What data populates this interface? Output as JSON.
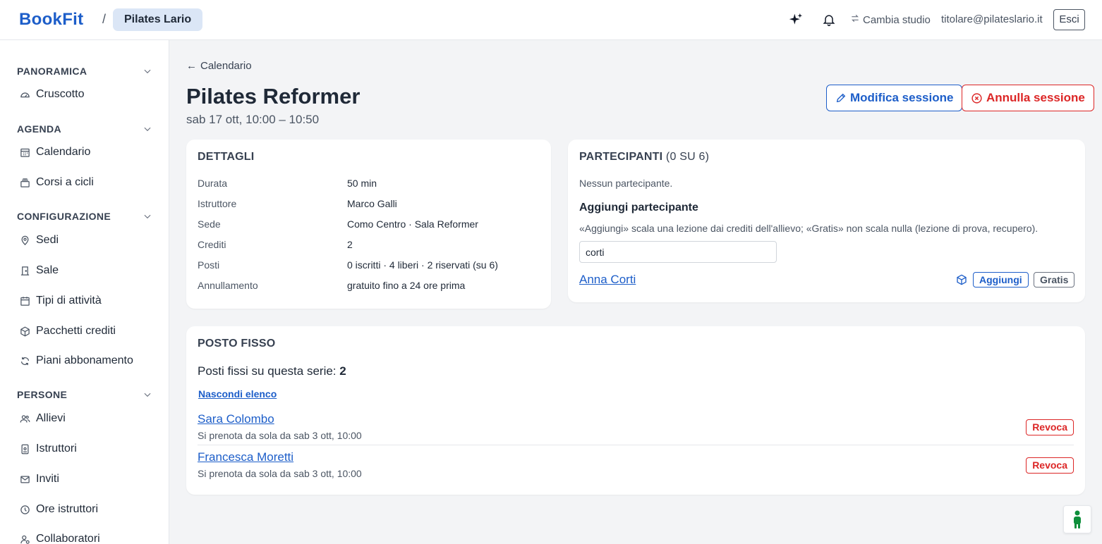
{
  "app": {
    "logo": "BookFit",
    "breadcrumb_sep": "/",
    "studio": "Pilates Lario"
  },
  "header": {
    "switch_studio": "Cambia studio",
    "user_email": "titolare@pilateslario.it",
    "logout": "Esci"
  },
  "sidebar": {
    "sections": [
      {
        "label": "PANORAMICA",
        "items": [
          {
            "label": "Cruscotto",
            "icon": "gauge-icon"
          }
        ]
      },
      {
        "label": "AGENDA",
        "items": [
          {
            "label": "Calendario",
            "icon": "calendar-grid-icon"
          },
          {
            "label": "Corsi a cicli",
            "icon": "stack-icon"
          }
        ]
      },
      {
        "label": "CONFIGURAZIONE",
        "items": [
          {
            "label": "Sedi",
            "icon": "map-pin-icon"
          },
          {
            "label": "Sale",
            "icon": "door-icon"
          },
          {
            "label": "Tipi di attività",
            "icon": "calendar-icon"
          },
          {
            "label": "Pacchetti crediti",
            "icon": "package-icon"
          },
          {
            "label": "Piani abbonamento",
            "icon": "refresh-icon"
          }
        ]
      },
      {
        "label": "PERSONE",
        "items": [
          {
            "label": "Allievi",
            "icon": "users-icon"
          },
          {
            "label": "Istruttori",
            "icon": "badge-icon"
          },
          {
            "label": "Inviti",
            "icon": "mail-icon"
          },
          {
            "label": "Ore istruttori",
            "icon": "clock-icon"
          },
          {
            "label": "Collaboratori",
            "icon": "user-cog-icon"
          }
        ]
      }
    ]
  },
  "page": {
    "back": "Calendario",
    "title": "Pilates Reformer",
    "subtitle": "sab 17 ott, 10:00 – 10:50",
    "edit_button": "Modifica sessione",
    "cancel_button": "Annulla sessione"
  },
  "details": {
    "title": "DETTAGLI",
    "rows": [
      {
        "key": "Durata",
        "value": "50 min"
      },
      {
        "key": "Istruttore",
        "value": "Marco Galli"
      },
      {
        "key": "Sede",
        "value": "Como Centro · Sala Reformer"
      },
      {
        "key": "Crediti",
        "value": "2"
      },
      {
        "key": "Posti",
        "value": "0 iscritti · 4 liberi · 2 riservati (su 6)"
      },
      {
        "key": "Annullamento",
        "value": "gratuito fino a 24 ore prima"
      }
    ]
  },
  "participants": {
    "title": "PARTECIPANTI",
    "count": "(0 SU 6)",
    "empty": "Nessun partecipante.",
    "add_title": "Aggiungi partecipante",
    "add_hint": "«Aggiungi» scala una lezione dai crediti dell'allievo; «Gratis» non scala nulla (lezione di prova, recupero).",
    "search_value": "corti",
    "result": {
      "name": "Anna Corti",
      "add": "Aggiungi",
      "free": "Gratis"
    }
  },
  "fixed": {
    "title": "POSTO FISSO",
    "count_label": "Posti fissi su questa serie:",
    "count": "2",
    "toggle": "Nascondi elenco",
    "items": [
      {
        "name": "Sara Colombo",
        "note": "Si prenota da sola da sab 3 ott, 10:00",
        "action": "Revoca"
      },
      {
        "name": "Francesca Moretti",
        "note": "Si prenota da sola da sab 3 ott, 10:00",
        "action": "Revoca"
      }
    ]
  },
  "colors": {
    "brand": "#1d5ec9",
    "danger": "#dc2626",
    "studio_pill": "#dbe6f6",
    "help": "#0e8f3b"
  }
}
